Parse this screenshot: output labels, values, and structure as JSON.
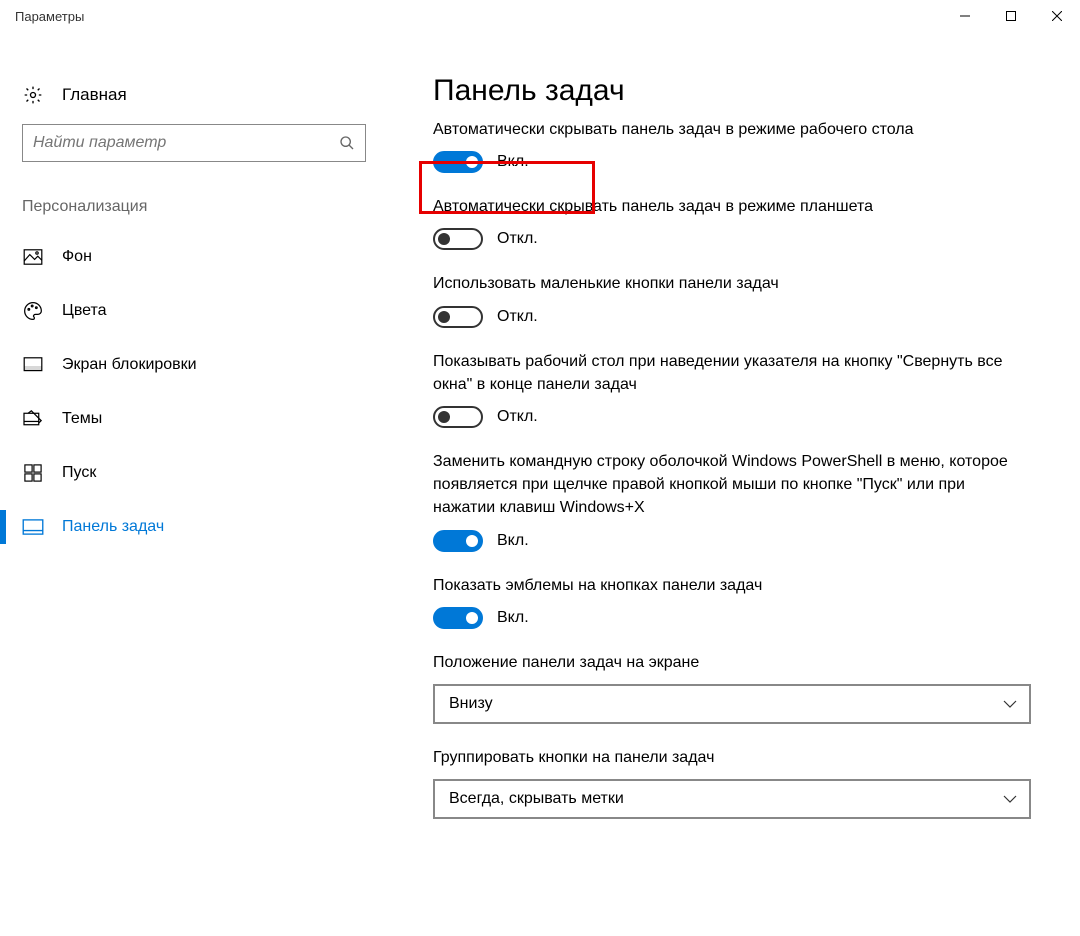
{
  "titlebar": {
    "title": "Параметры"
  },
  "sidebar": {
    "home_label": "Главная",
    "search_placeholder": "Найти параметр",
    "section_label": "Персонализация",
    "items": [
      {
        "label": "Фон",
        "selected": false
      },
      {
        "label": "Цвета",
        "selected": false
      },
      {
        "label": "Экран блокировки",
        "selected": false
      },
      {
        "label": "Темы",
        "selected": false
      },
      {
        "label": "Пуск",
        "selected": false
      },
      {
        "label": "Панель задач",
        "selected": true
      }
    ]
  },
  "main": {
    "heading": "Панель задач",
    "on_text": "Вкл.",
    "off_text": "Откл.",
    "settings": [
      {
        "label": "Автоматически скрывать панель задач в режиме рабочего стола",
        "value": true
      },
      {
        "label": "Автоматически скрывать панель задач в режиме планшета",
        "value": false
      },
      {
        "label": "Использовать маленькие кнопки панели задач",
        "value": false
      },
      {
        "label": "Показывать рабочий стол при наведении указателя на кнопку \"Свернуть все окна\" в конце панели задач",
        "value": false
      },
      {
        "label": "Заменить командную строку оболочкой Windows PowerShell в меню, которое появляется при щелчке правой кнопкой мыши по кнопке \"Пуск\" или при нажатии клавиш Windows+X",
        "value": true
      },
      {
        "label": "Показать эмблемы на кнопках панели задач",
        "value": true
      }
    ],
    "dropdowns": [
      {
        "label": "Положение панели задач на экране",
        "value": "Внизу"
      },
      {
        "label": "Группировать кнопки на панели задач",
        "value": "Всегда, скрывать метки"
      }
    ]
  }
}
